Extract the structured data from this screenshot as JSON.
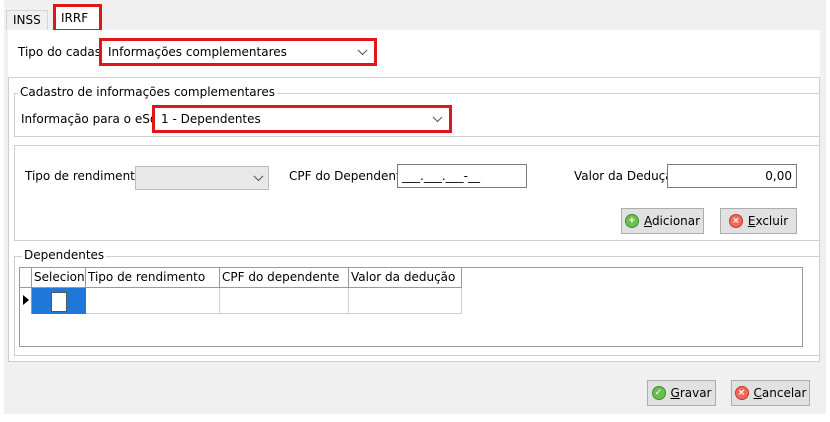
{
  "tabs": [
    {
      "label": "INSS"
    },
    {
      "label": "IRRF"
    }
  ],
  "tipo_cadastro": {
    "label": "Tipo do cadastro",
    "value": "Informações complementares"
  },
  "cadastro_info": {
    "group_title": "Cadastro de informações complementares",
    "esocial_label": "Informação para o eSocial:",
    "esocial_value": "1 - Dependentes"
  },
  "form": {
    "tipo_rendimento_label": "Tipo de rendimento:",
    "tipo_rendimento_value": "",
    "cpf_label": "CPF do Dependente:",
    "cpf_value": "___.___.___-__",
    "valor_label": "Valor da Dedução:",
    "valor_value": "0,00",
    "adicionar_prefix": "",
    "adicionar_u": "A",
    "adicionar_rest": "dicionar",
    "excluir_u": "E",
    "excluir_rest": "xcluir"
  },
  "dependentes": {
    "group_title": "Dependentes",
    "columns": [
      "Selecionar",
      "Tipo de rendimento",
      "CPF do dependente",
      "Valor da dedução"
    ],
    "rows": [
      {
        "selecionar": false,
        "tipo": "",
        "cpf": "",
        "valor": ""
      }
    ]
  },
  "footer": {
    "gravar_u": "G",
    "gravar_rest": "ravar",
    "cancelar_u": "C",
    "cancelar_rest": "ancelar"
  },
  "colors": {
    "highlight_red": "#e0161d",
    "selection_blue": "#1e78d7"
  },
  "icons": {
    "adicionar": "plus-circle-icon",
    "excluir": "x-circle-icon",
    "gravar": "check-circle-icon",
    "cancelar": "x-circle-icon"
  }
}
